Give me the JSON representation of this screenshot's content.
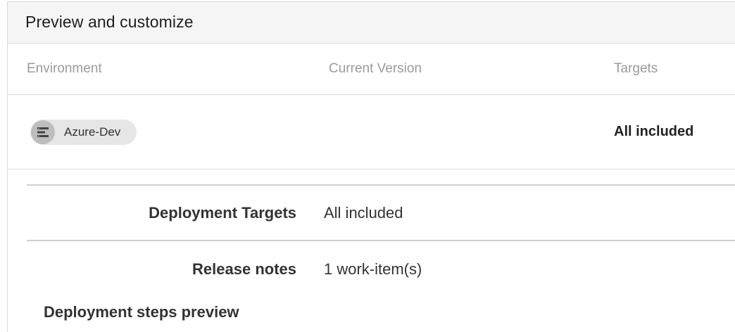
{
  "panel": {
    "title": "Preview and customize"
  },
  "table": {
    "columns": [
      "Environment",
      "Current Version",
      "Targets"
    ],
    "rows": [
      {
        "environment": "Azure-Dev",
        "environment_icon": "environment-icon",
        "current_version": "",
        "targets": "All included"
      }
    ]
  },
  "details": {
    "deployment_targets": {
      "label": "Deployment Targets",
      "value": "All included"
    },
    "release_notes": {
      "label": "Release notes",
      "value": "1 work-item(s)"
    },
    "steps_preview_title": "Deployment steps preview"
  },
  "colors": {
    "header_bg": "#f5f5f5",
    "chip_bg": "#e6e6e6",
    "muted_text": "#9b9b9b"
  }
}
